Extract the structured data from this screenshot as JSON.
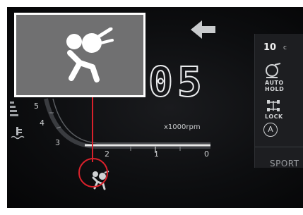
{
  "cluster": {
    "speed_digits": "05",
    "rpm_unit": "x1000rpm",
    "rpm_ticks": [
      "5",
      "4",
      "3",
      "2",
      "1",
      "0"
    ],
    "outside_temp": {
      "value": "10",
      "unit": "c"
    },
    "side_panel": {
      "auto_hold_line1": "AUTO",
      "auto_hold_line2": "HOLD",
      "lock_label": "LOCK",
      "auto_label": "A"
    },
    "drive_mode": "SPORT"
  },
  "callout": {
    "icon": "airbag-warning-icon",
    "highlight_color": "#d9212b"
  },
  "icons": {
    "direction_arrow": "arrow-left-icon",
    "coolant": "coolant-temperature-icon",
    "auto_hold": "auto-hold-icon",
    "diff_lock": "differential-lock-icon"
  }
}
